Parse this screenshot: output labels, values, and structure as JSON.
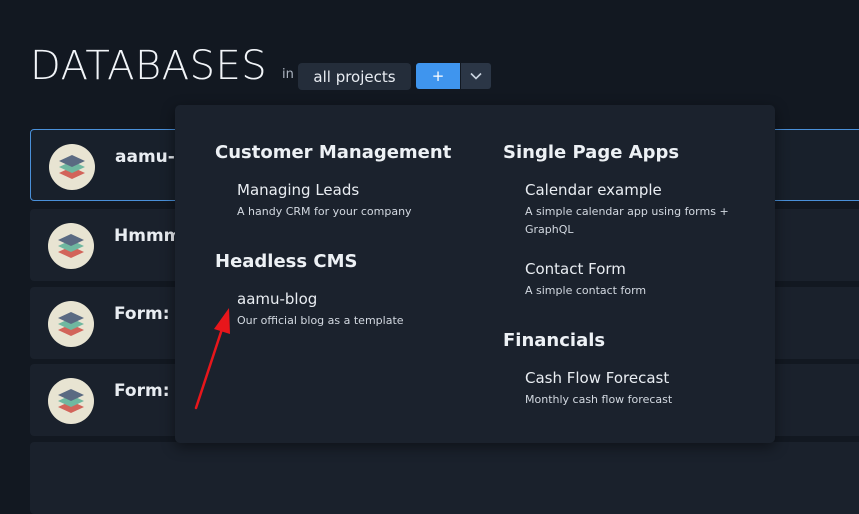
{
  "header": {
    "title": "DATABASES",
    "in_label": "in",
    "project_select_value": "all projects",
    "add_label": "+"
  },
  "databases": [
    {
      "name": "aamu-b"
    },
    {
      "name": "Hmmm"
    },
    {
      "name": "Form: Te"
    },
    {
      "name": "Form: Te"
    }
  ],
  "template_menu": {
    "left_column": [
      {
        "heading": "Customer Management",
        "items": [
          {
            "title": "Managing Leads",
            "description": "A handy CRM for your company"
          }
        ]
      },
      {
        "heading": "Headless CMS",
        "items": [
          {
            "title": "aamu-blog",
            "description": "Our official blog as a template"
          }
        ]
      }
    ],
    "right_column": [
      {
        "heading": "Single Page Apps",
        "items": [
          {
            "title": "Calendar example",
            "description": "A simple calendar app using forms + GraphQL"
          },
          {
            "title": "Contact Form",
            "description": "A simple contact form"
          }
        ]
      },
      {
        "heading": "Financials",
        "items": [
          {
            "title": "Cash Flow Forecast",
            "description": "Monthly cash flow forecast"
          }
        ]
      }
    ]
  },
  "icons": {
    "database_avatar": "database-stack-icon",
    "dropdown_toggle": "chevron-down-icon",
    "annotation": "red-arrow-annotation"
  },
  "colors": {
    "background": "#121821",
    "accent": "#3f95ee",
    "arrow": "#e8161b"
  }
}
